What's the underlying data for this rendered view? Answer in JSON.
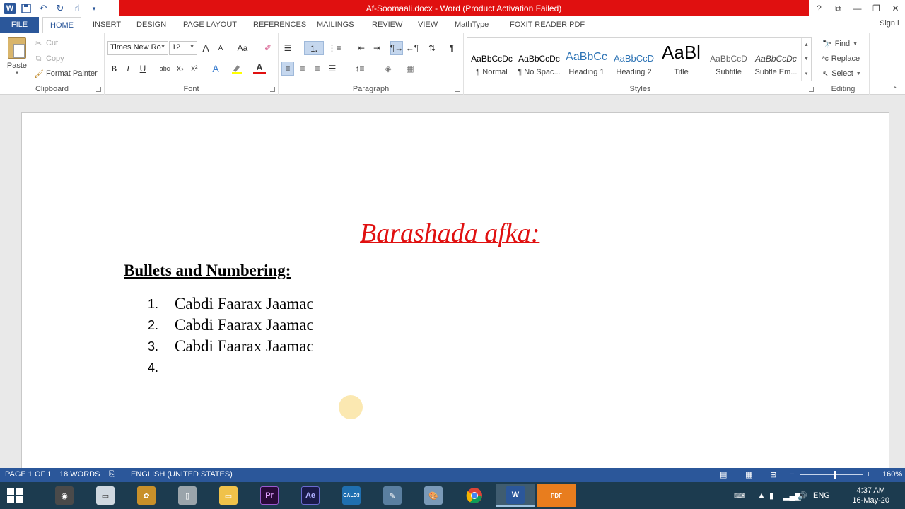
{
  "window": {
    "title": "Af-Soomaali.docx -  Word (Product Activation Failed)",
    "controls": [
      "?",
      "⧉",
      "—",
      "❐",
      "✕"
    ]
  },
  "tabs": {
    "file": "FILE",
    "items": [
      "HOME",
      "INSERT",
      "DESIGN",
      "PAGE LAYOUT",
      "REFERENCES",
      "MAILINGS",
      "REVIEW",
      "VIEW",
      "MathType",
      "FOXIT READER PDF"
    ],
    "active": "HOME",
    "signin": "Sign i"
  },
  "ribbon": {
    "clipboard": {
      "label": "Clipboard",
      "paste": "Paste",
      "cut": "Cut",
      "copy": "Copy",
      "format_painter": "Format Painter"
    },
    "font": {
      "label": "Font",
      "font_name": "Times New Ro",
      "font_size": "12",
      "bold": "B",
      "italic": "I",
      "underline": "U",
      "strike": "abc",
      "subscript": "x₂",
      "superscript": "x²",
      "grow": "A",
      "shrink": "A",
      "case": "Aa",
      "font_color": "A"
    },
    "paragraph": {
      "label": "Paragraph"
    },
    "styles": {
      "label": "Styles",
      "items": [
        {
          "sample": "AaBbCcDc",
          "name": "¶ Normal"
        },
        {
          "sample": "AaBbCcDc",
          "name": "¶ No Spac..."
        },
        {
          "sample": "AaBbCc",
          "name": "Heading 1"
        },
        {
          "sample": "AaBbCcD",
          "name": "Heading 2"
        },
        {
          "sample": "AaBl",
          "name": "Title"
        },
        {
          "sample": "AaBbCcD",
          "name": "Subtitle"
        },
        {
          "sample": "AaBbCcDc",
          "name": "Subtle Em..."
        }
      ]
    },
    "editing": {
      "label": "Editing",
      "find": "Find",
      "replace": "Replace",
      "select": "Select"
    }
  },
  "document": {
    "title": "Barashada afka:",
    "heading": "Bullets and Numbering:",
    "list": [
      {
        "num": "1.",
        "text": "Cabdi Faarax Jaamac"
      },
      {
        "num": "2.",
        "text": "Cabdi Faarax Jaamac"
      },
      {
        "num": "3.",
        "text": "Cabdi Faarax Jaamac"
      },
      {
        "num": "4.",
        "text": ""
      }
    ]
  },
  "status": {
    "page": "PAGE 1 OF 1",
    "words": "18 WORDS",
    "language": "ENGLISH (UNITED STATES)",
    "zoom": "160%"
  },
  "taskbar": {
    "apps": [
      "start",
      "media",
      "laptop",
      "fruit",
      "phone",
      "folder",
      "Pr",
      "Ae",
      "CALD3",
      "paint",
      "palette",
      "chrome",
      "W",
      "PDF"
    ],
    "language": "ENG",
    "time": "4:37 AM",
    "date": "16-May-20"
  },
  "colors": {
    "brand": "#2b579a",
    "title_bar_alert": "#e01010",
    "doc_title": "#e01010",
    "taskbar": "#1c3b4f"
  }
}
